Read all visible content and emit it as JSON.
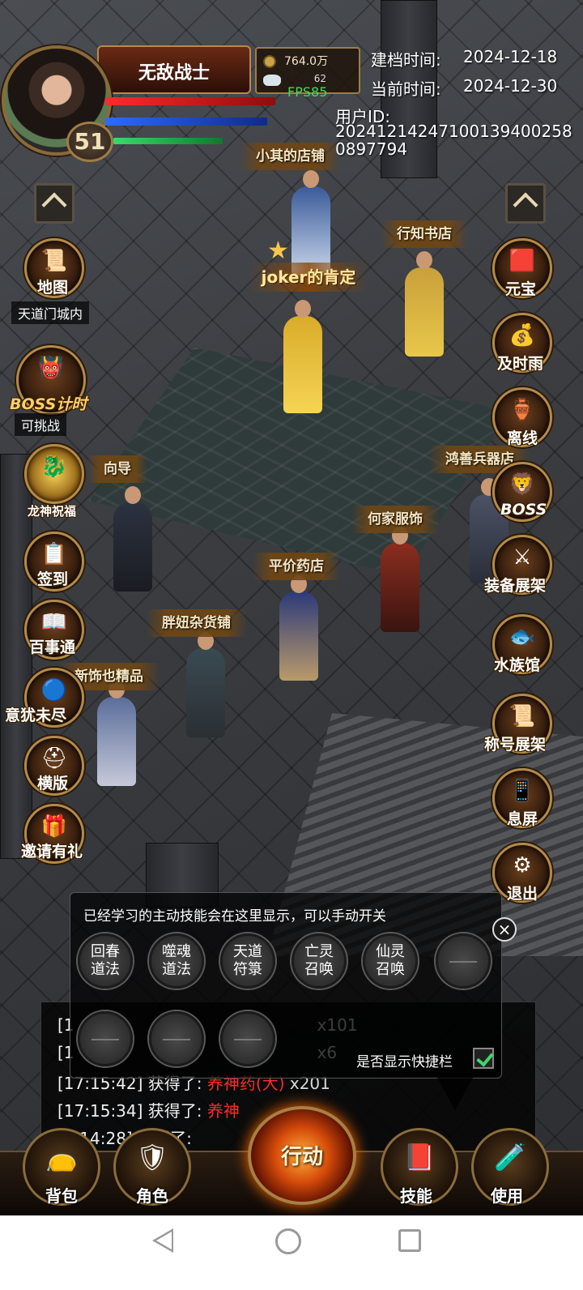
{
  "player": {
    "name": "无敌战士",
    "level": "51",
    "gold": "764.0万",
    "ingots": "62",
    "fps": "FPS85"
  },
  "info": {
    "created_label": "建档时间:",
    "created_value": "2024-12-18",
    "current_label": "当前时间:",
    "current_value": "2024-12-30",
    "user_id_label": "用户ID:",
    "user_id_line1": "20241214247100139400258",
    "user_id_line2": "0897794"
  },
  "npcs": {
    "xiaoqi": "小其的店铺",
    "xingzhi": "行知书店",
    "guide": "向导",
    "hongshan": "鸿善兵器店",
    "hejia": "何家服饰",
    "pingjia": "平价药店",
    "pangniu": "胖妞杂货铺",
    "xinshi": "新饰也精品"
  },
  "title_banner": "joker的肯定",
  "left_menu": {
    "map": "地图",
    "map_sub": "天道门城内",
    "boss_timer": "BOSS计时",
    "boss_timer_sub": "可挑战",
    "dragon_blessing": "龙神祝福",
    "signin": "签到",
    "baishitong": "百事通",
    "yiyouweijin": "意犹未尽",
    "hengban": "横版",
    "invite": "邀请有礼"
  },
  "right_menu": {
    "yuanbao": "元宝",
    "jishiyu": "及时雨",
    "offline": "离线",
    "boss": "BOSS",
    "equipment_display": "装备展架",
    "aquarium": "水族馆",
    "title_display": "称号展架",
    "screen_off": "息屏",
    "exit": "退出"
  },
  "chat": {
    "lines": [
      {
        "time": "[1",
        "text": "",
        "item": "",
        "qty": "x101"
      },
      {
        "time": "[1",
        "text": "",
        "item": "",
        "qty": "x6"
      },
      {
        "time": "[17:15:42]",
        "text": " 获得了: ",
        "item": "养神药(大)",
        "qty": " x201"
      },
      {
        "time": "[17:15:34]",
        "text": " 获得了: ",
        "item": "养神",
        "qty": ""
      },
      {
        "time": "[",
        "text": "7:14:28] 获得了: ",
        "item": "",
        "qty": ""
      }
    ]
  },
  "skill_panel": {
    "hint": "已经学习的主动技能会在这里显示，可以手动开关",
    "close": "×",
    "skills": [
      "回春\n道法",
      "噬魂\n道法",
      "天道\n符箓",
      "亡灵\n召唤",
      "仙灵\n召唤"
    ],
    "quickbar_label": "是否显示快捷栏",
    "quickbar_checked": true
  },
  "bottom": {
    "bag": "背包",
    "character": "角色",
    "action": "行动",
    "skills": "技能",
    "use": "使用"
  },
  "colors": {
    "hp": "#ff2b2b",
    "mp": "#2d6bff",
    "exp": "#3bd96a",
    "item_red": "#ff2a2a",
    "fps_green": "#38e05a"
  }
}
